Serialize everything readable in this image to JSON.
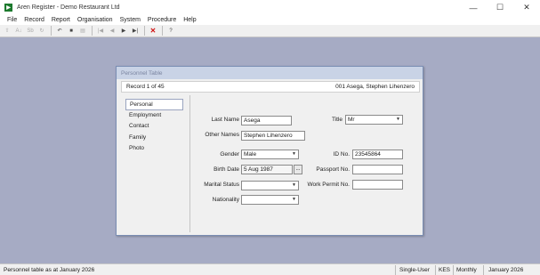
{
  "window": {
    "title": "Aren Register - Demo Restaurant Ltd",
    "controls": [
      "—",
      "☐",
      "✕"
    ]
  },
  "menu": [
    "File",
    "Record",
    "Report",
    "Organisation",
    "System",
    "Procedure",
    "Help"
  ],
  "toolbar": {
    "buttons": [
      {
        "name": "up-icon",
        "glyph": "⇧",
        "disabled": true
      },
      {
        "name": "sort-ascending-icon",
        "glyph": "A↓",
        "disabled": true
      },
      {
        "name": "sort-descending-icon",
        "glyph": "Sb",
        "disabled": true
      },
      {
        "name": "refresh-icon",
        "glyph": "↻",
        "disabled": true
      },
      {
        "name": "undo-icon",
        "glyph": "↶",
        "disabled": false
      },
      {
        "name": "save-icon",
        "glyph": "■",
        "disabled": false
      },
      {
        "name": "print-icon",
        "glyph": "▤",
        "disabled": true
      },
      {
        "name": "first-record-icon",
        "glyph": "|◀",
        "disabled": true
      },
      {
        "name": "previous-record-icon",
        "glyph": "◀",
        "disabled": true
      },
      {
        "name": "next-record-icon",
        "glyph": "▶",
        "disabled": false
      },
      {
        "name": "last-record-icon",
        "glyph": "▶|",
        "disabled": false
      },
      {
        "name": "delete-icon",
        "glyph": "✕",
        "disabled": false,
        "red": true
      },
      {
        "name": "help-icon",
        "glyph": "?",
        "disabled": false
      }
    ]
  },
  "dialog": {
    "title": "Personnel Table",
    "record_position": "Record 1 of 45",
    "record_name": "001  Asega, Stephen Lihenzero",
    "nav": [
      "Personal",
      "Employment",
      "Contact",
      "Family",
      "Photo"
    ],
    "active_nav": "Personal",
    "form": {
      "last_name_label": "Last Name",
      "last_name": "Asega",
      "other_names_label": "Other Names",
      "other_names": "Stephen Lihenzero",
      "gender_label": "Gender",
      "gender": "Male",
      "birth_date_label": "Birth Date",
      "birth_date": "5 Aug 1987",
      "birth_date_button": "...",
      "marital_status_label": "Marital Status",
      "marital_status": "",
      "nationality_label": "Nationality",
      "nationality": "",
      "title_label": "Title",
      "title": "Mr",
      "id_no_label": "ID No.",
      "id_no": "23545864",
      "passport_label": "Passport No.",
      "passport": "",
      "work_permit_label": "Work Permit No.",
      "work_permit": ""
    }
  },
  "status": {
    "message": "Personnel table as at January 2026",
    "mode": "Single-User",
    "currency": "KES",
    "frequency": "Monthly",
    "period": "January 2026"
  },
  "colors": {
    "workspace": "#a6abc4",
    "app_icon": "#1d7a2e",
    "delete": "#d01010"
  }
}
